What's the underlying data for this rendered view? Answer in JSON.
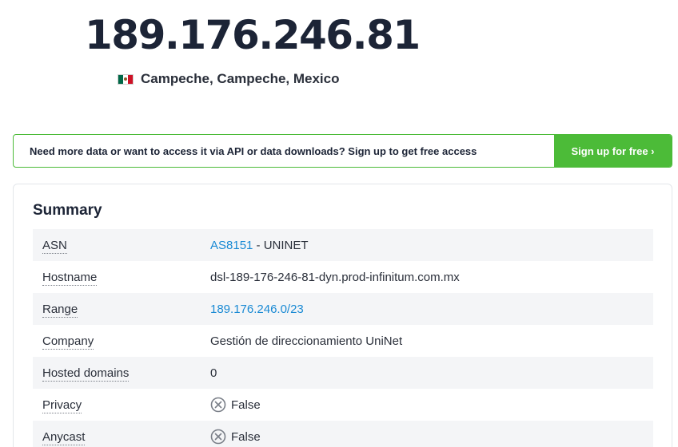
{
  "header": {
    "ip": "189.176.246.81",
    "location": "Campeche, Campeche, Mexico",
    "flag_icon": "mexico-flag-icon"
  },
  "banner": {
    "text": "Need more data or want to access it via API or data downloads? Sign up to get free access",
    "button_label": "Sign up for free ›",
    "accent_color": "#4cbb38"
  },
  "summary": {
    "title": "Summary",
    "rows": {
      "asn": {
        "label": "ASN",
        "link": "AS8151",
        "rest": " - UNINET"
      },
      "hostname": {
        "label": "Hostname",
        "value": "dsl-189-176-246-81-dyn.prod-infinitum.com.mx"
      },
      "range": {
        "label": "Range",
        "link": "189.176.246.0/23"
      },
      "company": {
        "label": "Company",
        "value": "Gestión de direccionamiento UniNet"
      },
      "hosted_domains": {
        "label": "Hosted domains",
        "value": "0"
      },
      "privacy": {
        "label": "Privacy",
        "value": "False",
        "icon": "x-circle-icon"
      },
      "anycast": {
        "label": "Anycast",
        "value": "False",
        "icon": "x-circle-icon"
      }
    }
  }
}
